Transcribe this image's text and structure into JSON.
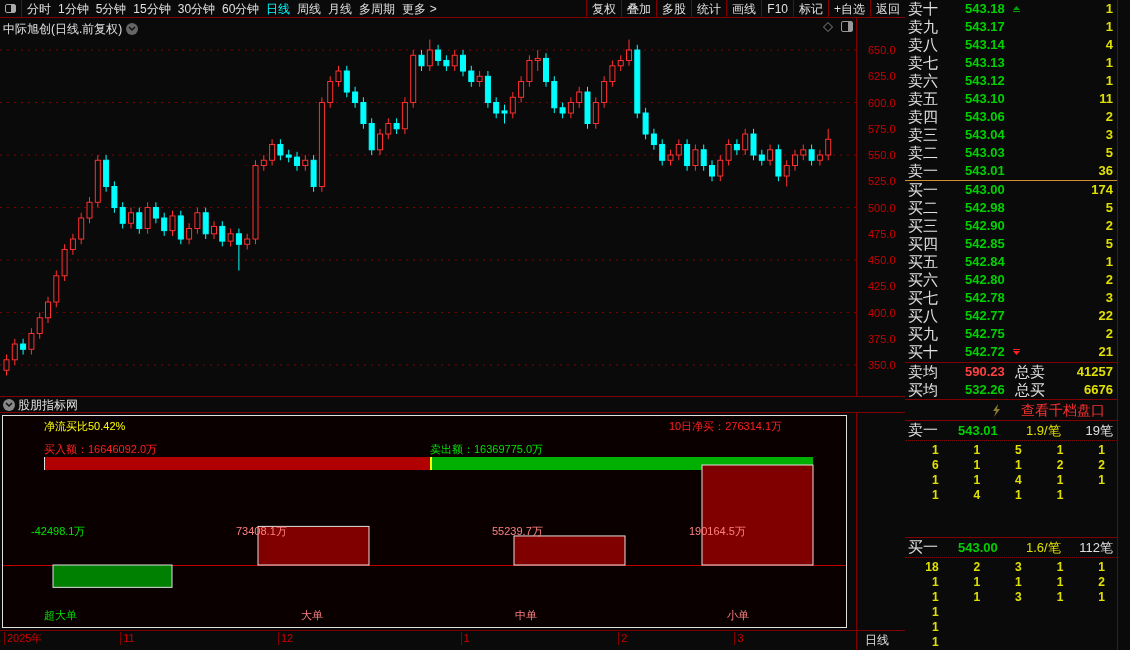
{
  "toolbar": {
    "periods": [
      {
        "label": "分时",
        "selected": false
      },
      {
        "label": "1分钟",
        "selected": false
      },
      {
        "label": "5分钟",
        "selected": false
      },
      {
        "label": "15分钟",
        "selected": false
      },
      {
        "label": "30分钟",
        "selected": false
      },
      {
        "label": "60分钟",
        "selected": false
      },
      {
        "label": "日线",
        "selected": true
      },
      {
        "label": "周线",
        "selected": false
      },
      {
        "label": "月线",
        "selected": false
      },
      {
        "label": "多周期",
        "selected": false
      },
      {
        "label": "更多 >",
        "selected": false
      }
    ],
    "buttons": [
      "复权",
      "叠加",
      "多股",
      "统计",
      "画线",
      "F10",
      "标记",
      "+自选",
      "返回"
    ]
  },
  "chart": {
    "title": "中际旭创(日线.前复权)",
    "chart_data": {
      "type": "candlestick",
      "grid": true,
      "ylim": [
        320.5,
        680.5
      ],
      "ohlc": [
        [
          345,
          360,
          340,
          355
        ],
        [
          355,
          375,
          350,
          370
        ],
        [
          370,
          375,
          360,
          365
        ],
        [
          365,
          385,
          360,
          380
        ],
        [
          380,
          400,
          375,
          395
        ],
        [
          395,
          415,
          390,
          410
        ],
        [
          410,
          440,
          405,
          435
        ],
        [
          435,
          465,
          430,
          460
        ],
        [
          460,
          475,
          455,
          470
        ],
        [
          470,
          495,
          465,
          490
        ],
        [
          490,
          510,
          485,
          505
        ],
        [
          505,
          550,
          500,
          545
        ],
        [
          545,
          550,
          515,
          520
        ],
        [
          520,
          525,
          495,
          500
        ],
        [
          500,
          505,
          480,
          485
        ],
        [
          485,
          500,
          480,
          495
        ],
        [
          495,
          500,
          475,
          480
        ],
        [
          480,
          505,
          475,
          500
        ],
        [
          500,
          505,
          485,
          490
        ],
        [
          490,
          495,
          473,
          478
        ],
        [
          478,
          497,
          473,
          492
        ],
        [
          492,
          497,
          465,
          470
        ],
        [
          470,
          485,
          465,
          480
        ],
        [
          480,
          500,
          475,
          495
        ],
        [
          495,
          500,
          470,
          475
        ],
        [
          475,
          487,
          470,
          482
        ],
        [
          482,
          487,
          463,
          468
        ],
        [
          468,
          480,
          463,
          475
        ],
        [
          475,
          480,
          440,
          465
        ],
        [
          465,
          475,
          460,
          470
        ],
        [
          470,
          545,
          465,
          540
        ],
        [
          540,
          550,
          535,
          545
        ],
        [
          545,
          565,
          540,
          560
        ],
        [
          560,
          565,
          545,
          550
        ],
        [
          550,
          555,
          543,
          548
        ],
        [
          548,
          553,
          535,
          540
        ],
        [
          540,
          550,
          535,
          545
        ],
        [
          545,
          550,
          515,
          520
        ],
        [
          520,
          605,
          515,
          600
        ],
        [
          600,
          625,
          595,
          620
        ],
        [
          620,
          635,
          615,
          630
        ],
        [
          630,
          635,
          605,
          610
        ],
        [
          610,
          615,
          595,
          600
        ],
        [
          600,
          605,
          575,
          580
        ],
        [
          580,
          585,
          550,
          555
        ],
        [
          555,
          575,
          550,
          570
        ],
        [
          570,
          585,
          565,
          580
        ],
        [
          580,
          585,
          570,
          575
        ],
        [
          575,
          605,
          570,
          600
        ],
        [
          600,
          650,
          595,
          645
        ],
        [
          645,
          650,
          630,
          635
        ],
        [
          635,
          660,
          630,
          650
        ],
        [
          650,
          655,
          635,
          640
        ],
        [
          640,
          645,
          630,
          635
        ],
        [
          635,
          650,
          630,
          645
        ],
        [
          645,
          650,
          625,
          630
        ],
        [
          630,
          635,
          615,
          620
        ],
        [
          620,
          630,
          615,
          625
        ],
        [
          625,
          630,
          595,
          600
        ],
        [
          600,
          605,
          585,
          590
        ],
        [
          592,
          598,
          580,
          590
        ],
        [
          590,
          610,
          585,
          605
        ],
        [
          605,
          625,
          600,
          620
        ],
        [
          620,
          645,
          615,
          640
        ],
        [
          640,
          650,
          630,
          642
        ],
        [
          642,
          647,
          615,
          620
        ],
        [
          620,
          625,
          590,
          595
        ],
        [
          595,
          600,
          585,
          590
        ],
        [
          590,
          605,
          585,
          600
        ],
        [
          600,
          615,
          595,
          610
        ],
        [
          610,
          615,
          575,
          580
        ],
        [
          580,
          605,
          575,
          600
        ],
        [
          600,
          625,
          595,
          620
        ],
        [
          620,
          640,
          615,
          635
        ],
        [
          635,
          645,
          630,
          640
        ],
        [
          640,
          660,
          635,
          650
        ],
        [
          650,
          655,
          585,
          590
        ],
        [
          590,
          595,
          565,
          570
        ],
        [
          570,
          575,
          555,
          560
        ],
        [
          560,
          565,
          540,
          545
        ],
        [
          545,
          555,
          540,
          550
        ],
        [
          550,
          565,
          545,
          560
        ],
        [
          560,
          565,
          535,
          540
        ],
        [
          540,
          560,
          535,
          555
        ],
        [
          555,
          560,
          535,
          540
        ],
        [
          540,
          545,
          525,
          530
        ],
        [
          530,
          550,
          525,
          545
        ],
        [
          545,
          565,
          540,
          560
        ],
        [
          560,
          565,
          550,
          555
        ],
        [
          555,
          575,
          550,
          570
        ],
        [
          570,
          575,
          545,
          550
        ],
        [
          550,
          555,
          540,
          545
        ],
        [
          545,
          560,
          540,
          555
        ],
        [
          555,
          560,
          525,
          530
        ],
        [
          530,
          545,
          520,
          540
        ],
        [
          540,
          555,
          535,
          550
        ],
        [
          550,
          560,
          545,
          555
        ],
        [
          555,
          560,
          540,
          545
        ],
        [
          545,
          555,
          540,
          550
        ],
        [
          550,
          575,
          545,
          565
        ]
      ],
      "yticks": [
        {
          "value": 650,
          "label": "650.0"
        },
        {
          "value": 625,
          "label": "625.0"
        },
        {
          "value": 600,
          "label": "600.0"
        },
        {
          "value": 575,
          "label": "575.0"
        },
        {
          "value": 550,
          "label": "550.0"
        },
        {
          "value": 525,
          "label": "525.0"
        },
        {
          "value": 500,
          "label": "500.0"
        },
        {
          "value": 475,
          "label": "475.0"
        },
        {
          "value": 450,
          "label": "450.0"
        },
        {
          "value": 425,
          "label": "425.0"
        },
        {
          "value": 400,
          "label": "400.0"
        },
        {
          "value": 375,
          "label": "375.0"
        },
        {
          "value": 350,
          "label": "350.0"
        }
      ]
    }
  },
  "indicator": {
    "title": "股朋指标网",
    "net_ratio": "净流买比50.42%",
    "net_10d": "10日净买：276314.1万",
    "buy_amount": "买入额：16646092.0万",
    "sell_amount": "卖出额：16369775.0万",
    "level": 0.5042,
    "chart_data": {
      "type": "bar",
      "categories": [
        "超大单",
        "大单",
        "中单",
        "小单"
      ],
      "values": [
        -42498.1,
        73408.1,
        55239.7,
        190164.5
      ],
      "value_labels": [
        "-42498.1万",
        "73408.1万",
        "55239.7万",
        "190164.5万"
      ]
    }
  },
  "time_axis": [
    "2025年",
    "11",
    "12",
    "1",
    "2",
    "3"
  ],
  "period_label": "日线",
  "order_book": {
    "asks": [
      {
        "label": "卖十",
        "price": "543.18",
        "volume": "1"
      },
      {
        "label": "卖九",
        "price": "543.17",
        "volume": "1"
      },
      {
        "label": "卖八",
        "price": "543.14",
        "volume": "4"
      },
      {
        "label": "卖七",
        "price": "543.13",
        "volume": "1"
      },
      {
        "label": "卖六",
        "price": "543.12",
        "volume": "1"
      },
      {
        "label": "卖五",
        "price": "543.10",
        "volume": "11"
      },
      {
        "label": "卖四",
        "price": "543.06",
        "volume": "2"
      },
      {
        "label": "卖三",
        "price": "543.04",
        "volume": "3"
      },
      {
        "label": "卖二",
        "price": "543.03",
        "volume": "5"
      },
      {
        "label": "卖一",
        "price": "543.01",
        "volume": "36"
      }
    ],
    "bids": [
      {
        "label": "买一",
        "price": "543.00",
        "volume": "174"
      },
      {
        "label": "买二",
        "price": "542.98",
        "volume": "5"
      },
      {
        "label": "买三",
        "price": "542.90",
        "volume": "2"
      },
      {
        "label": "买四",
        "price": "542.85",
        "volume": "5"
      },
      {
        "label": "买五",
        "price": "542.84",
        "volume": "1"
      },
      {
        "label": "买六",
        "price": "542.80",
        "volume": "2"
      },
      {
        "label": "买七",
        "price": "542.78",
        "volume": "3"
      },
      {
        "label": "买八",
        "price": "542.77",
        "volume": "22"
      },
      {
        "label": "买九",
        "price": "542.75",
        "volume": "2"
      },
      {
        "label": "买十",
        "price": "542.72",
        "volume": "21"
      }
    ],
    "summary": [
      {
        "label": "卖均",
        "price": "590.23",
        "color": "#ff4040",
        "total_label": "总卖",
        "total": "41257"
      },
      {
        "label": "买均",
        "price": "532.26",
        "color": "#00d000",
        "total_label": "总买",
        "total": "6676"
      }
    ],
    "depth_link": "查看千档盘口",
    "queues": [
      {
        "label": "卖一",
        "price": "543.01",
        "avg": "1.9/笔",
        "count": "19笔",
        "rows": [
          [
            "1",
            "1",
            "5",
            "1",
            "1"
          ],
          [
            "6",
            "1",
            "1",
            "2",
            "2"
          ],
          [
            "1",
            "1",
            "4",
            "1",
            "1"
          ],
          [
            "1",
            "4",
            "1",
            "1"
          ]
        ]
      },
      {
        "label": "买一",
        "price": "543.00",
        "avg": "1.6/笔",
        "count": "112笔",
        "rows": [
          [
            "18",
            "2",
            "3",
            "1",
            "1"
          ],
          [
            "1",
            "1",
            "1",
            "1",
            "2"
          ],
          [
            "1",
            "1",
            "3",
            "1",
            "1"
          ],
          [
            "1"
          ],
          [
            "1"
          ],
          [
            "1"
          ]
        ]
      }
    ]
  }
}
